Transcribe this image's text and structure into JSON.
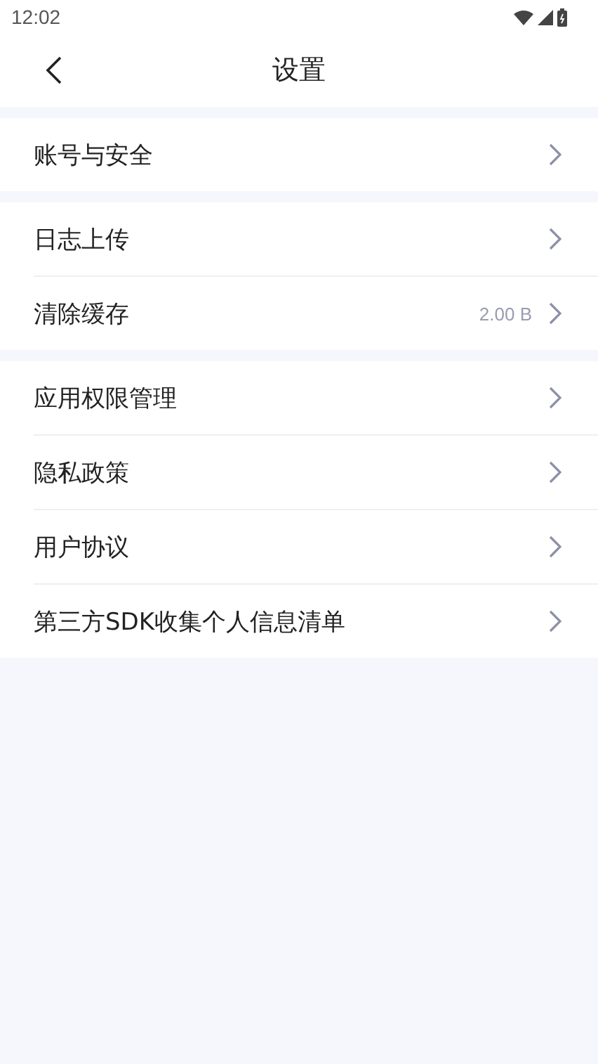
{
  "status_bar": {
    "time": "12:02"
  },
  "header": {
    "title": "设置"
  },
  "groups": [
    {
      "items": [
        {
          "label": "账号与安全"
        }
      ]
    },
    {
      "items": [
        {
          "label": "日志上传"
        },
        {
          "label": "清除缓存",
          "value": "2.00 B"
        }
      ]
    },
    {
      "items": [
        {
          "label": "应用权限管理"
        },
        {
          "label": "隐私政策"
        },
        {
          "label": "用户协议"
        },
        {
          "label": "第三方SDK收集个人信息清单"
        }
      ]
    }
  ]
}
